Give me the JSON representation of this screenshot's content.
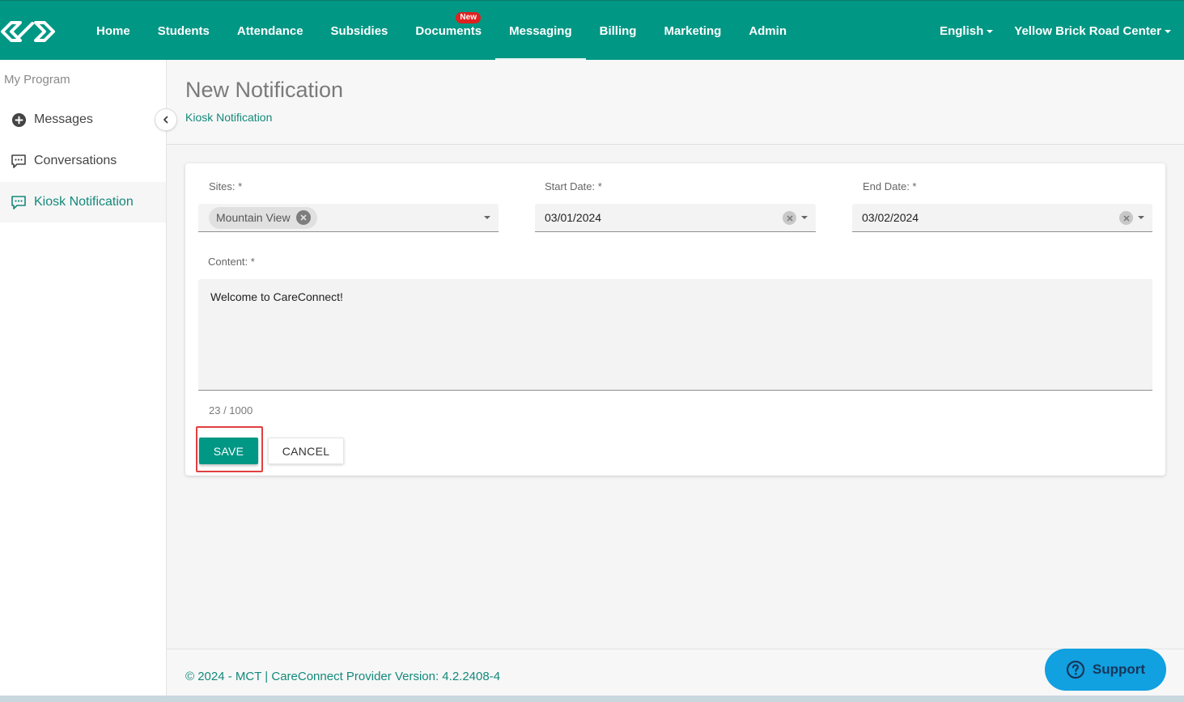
{
  "nav": {
    "items": [
      {
        "label": "Home"
      },
      {
        "label": "Students"
      },
      {
        "label": "Attendance"
      },
      {
        "label": "Subsidies"
      },
      {
        "label": "Documents",
        "badge": "New"
      },
      {
        "label": "Messaging",
        "active": true
      },
      {
        "label": "Billing"
      },
      {
        "label": "Marketing"
      },
      {
        "label": "Admin"
      }
    ],
    "language": "English",
    "center": "Yellow Brick Road Center"
  },
  "sidebar": {
    "heading": "My Program",
    "items": [
      {
        "label": "Messages",
        "icon": "plus-circle-icon"
      },
      {
        "label": "Conversations",
        "icon": "chat-icon"
      },
      {
        "label": "Kiosk Notification",
        "icon": "chat-icon",
        "active": true
      }
    ]
  },
  "header": {
    "title": "New Notification",
    "breadcrumb": "Kiosk Notification"
  },
  "form": {
    "sites_label": "Sites: *",
    "sites_chip": "Mountain View",
    "start_label": "Start Date: *",
    "start_value": "03/01/2024",
    "end_label": "End Date: *",
    "end_value": "03/02/2024",
    "content_label": "Content: *",
    "content_value": "Welcome to CareConnect!",
    "counter": "23 / 1000",
    "save_label": "SAVE",
    "cancel_label": "CANCEL"
  },
  "footer": {
    "text": "© 2024 - MCT | CareConnect Provider Version: 4.2.2408-4",
    "support_label": "Support"
  },
  "colors": {
    "brand": "#009784",
    "link": "#13897a",
    "badge": "#e02020",
    "support": "#11a0e0",
    "highlight": "#e04040"
  }
}
